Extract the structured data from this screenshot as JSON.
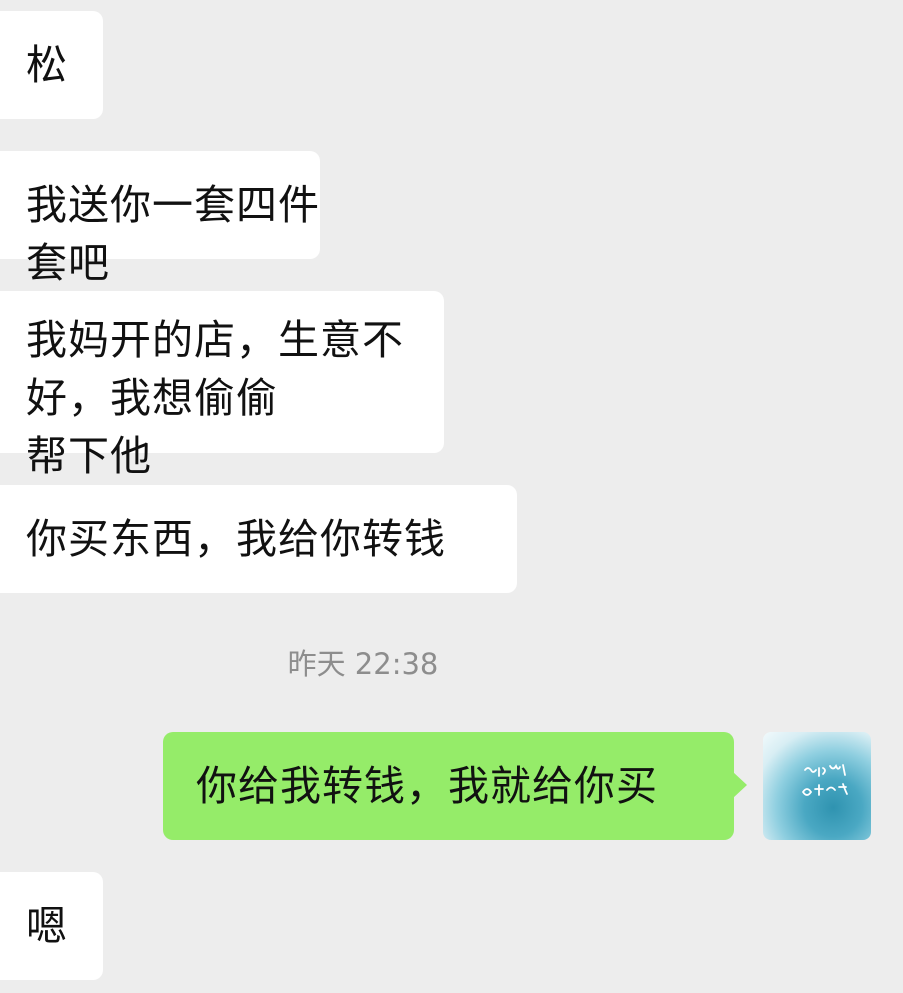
{
  "messages": [
    {
      "sender": "other",
      "text": "松"
    },
    {
      "sender": "other",
      "text": "我送你一套四件套吧"
    },
    {
      "sender": "other",
      "lines": [
        "我妈开的店，生意不好，我想偷偷",
        "帮下他"
      ]
    },
    {
      "sender": "other",
      "text": "你买东西，我给你转钱"
    },
    {
      "type": "timestamp",
      "text": "昨天 22:38"
    },
    {
      "sender": "me",
      "text": "你给我转钱，我就给你买",
      "avatar_icon": "avatar-image"
    },
    {
      "sender": "other",
      "text": "嗯"
    }
  ],
  "colors": {
    "background": "#ededed",
    "incoming_bubble": "#ffffff",
    "outgoing_bubble": "#95ec69",
    "timestamp_text": "#8d8d8d"
  }
}
